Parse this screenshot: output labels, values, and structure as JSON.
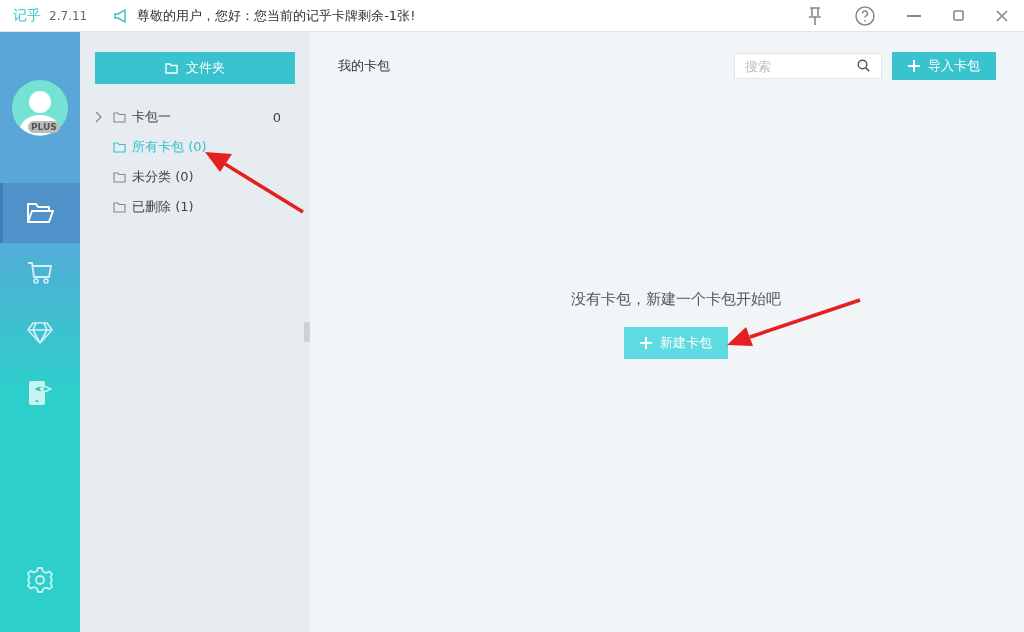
{
  "titlebar": {
    "app_name": "记乎",
    "version": "2.7.11",
    "notice": "尊敬的用户，您好：您当前的记乎卡牌剩余-1张!"
  },
  "nav": {
    "badge": "PLUS",
    "items": [
      {
        "kind": "folder",
        "selected": true
      },
      {
        "kind": "cart",
        "selected": false
      },
      {
        "kind": "diamond",
        "selected": false
      },
      {
        "kind": "phone-eye",
        "selected": false
      }
    ]
  },
  "folder_panel": {
    "header_button": "文件夹",
    "items": [
      {
        "label": "卡包一",
        "count": "0",
        "expanded": false,
        "selected": false
      },
      {
        "label": "所有卡包 (0)",
        "selected": true
      },
      {
        "label": "未分类 (0)",
        "selected": false
      },
      {
        "label": "已删除 (1)",
        "selected": false
      }
    ]
  },
  "main": {
    "title": "我的卡包",
    "search": {
      "placeholder": "搜索"
    },
    "import_button": "导入卡包",
    "empty_message": "没有卡包，新建一个卡包开始吧",
    "new_button": "新建卡包"
  }
}
